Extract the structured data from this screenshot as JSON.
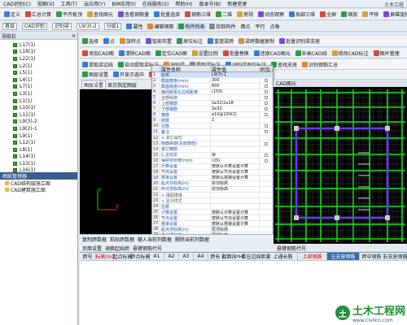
{
  "menubar": {
    "items": [
      "CAD识别(C)",
      "视图(V)",
      "工具(T)",
      "云应用(Y)",
      "BIM应用(I)",
      "在线服务(S)",
      "帮助(H)",
      "版本号(B)",
      "新建变更"
    ],
    "title_right": "土木工程"
  },
  "toolbar1": {
    "items": [
      "定义",
      "汇总计算",
      "平齐板顶",
      "查找图元",
      "查看钢筋量",
      "批量选择",
      "钢筋三维",
      "二维",
      "俯视",
      "动态观察",
      "局部三维",
      "全屏",
      "缩放",
      "平移",
      "屏幕旋转"
    ]
  },
  "toolbar2": {
    "floor": "首层",
    "category": "CAD识别",
    "layer": "识别梁",
    "component": "L9(3)-2",
    "subclass": "分层1",
    "items": [
      "属性",
      "编辑钢筋",
      "构件列表",
      "拾取构件",
      "两点",
      "平行",
      "点角"
    ]
  },
  "toolbar3": {
    "items": [
      "选择",
      "点",
      "旋转点",
      "智能布置",
      "原位标注",
      "重提梁跨",
      "梁跨数据复制",
      "批量识别梁支座"
    ]
  },
  "toolbar4": {
    "items": [
      "添加CAD图",
      "清除CAD图",
      "定位CAD图",
      "设置比例",
      "批量替换",
      "还原CAD图元",
      "补画CAD线",
      "修改CAD标注",
      "图片管理"
    ]
  },
  "toolbar5": {
    "items": [
      "提取梁边线",
      "自动提取梁标注",
      "识别梁",
      "提取梁标注",
      "识别梁原位标注",
      "查找支座",
      "识别钢筋汇总"
    ]
  },
  "toolbar6": {
    "items": [
      "图层设置",
      "只显示选中",
      "识别梁",
      "校核原位标注",
      "启用预制"
    ]
  },
  "left_panel": {
    "header": "导航栏",
    "close": "×",
    "items": [
      "L17(1)",
      "L18(1)",
      "L22(1)",
      "L2(1)",
      "L5(1)",
      "L4(1)",
      "L7(1)",
      "L3(1)",
      "L1(1)",
      "L10(1)",
      "L11(1)",
      "L9(3)-2",
      "L9(2)-1",
      "L9(1)",
      "L12(1)",
      "L8(1)",
      "L14(1)",
      "L13(1)",
      "L16(1)",
      "L15(1)-1",
      "L6(1)"
    ]
  },
  "nav_panel": {
    "header": "图纸管理器",
    "items": [
      "CAD结构层施工图",
      "CAD建筑施工图"
    ]
  },
  "cad_tabs": {
    "items": [
      "图层设置",
      "显示指定图层"
    ]
  },
  "props": {
    "col_attr": "属性名称",
    "col_value": "属性值",
    "col_extra": "附加",
    "rows": [
      {
        "n": "1",
        "name": "名称",
        "value": "L9(3)-2",
        "grp": false,
        "cb": false
      },
      {
        "n": "2",
        "name": "截面宽度(mm)",
        "value": "300",
        "grp": false,
        "cb": true
      },
      {
        "n": "3",
        "name": "截面高度(mm)",
        "value": "600",
        "grp": false,
        "cb": true
      },
      {
        "n": "4",
        "name": "轴线距梁左边线距离",
        "value": "(150)",
        "grp": false,
        "cb": true
      },
      {
        "n": "5",
        "name": "全部纵筋",
        "value": "",
        "grp": true,
        "cb": true
      },
      {
        "n": "6",
        "name": "上部钢筋",
        "value": "2⌀32/2⌀18",
        "grp": false,
        "cb": true
      },
      {
        "n": "7",
        "name": "下部钢筋",
        "value": "3⌀32",
        "grp": false,
        "cb": true
      },
      {
        "n": "8",
        "name": "箍筋",
        "value": "⌀10@100(2)",
        "grp": false,
        "cb": true
      },
      {
        "n": "9",
        "name": "肢数",
        "value": "2",
        "grp": false,
        "cb": false
      },
      {
        "n": "10",
        "name": "拉筋",
        "value": "",
        "grp": false,
        "cb": true
      },
      {
        "n": "11",
        "name": "备注",
        "value": "",
        "grp": false,
        "cb": true
      },
      {
        "n": "12",
        "name": "+ 其它属性",
        "value": "",
        "grp": true,
        "cb": false
      },
      {
        "n": "13",
        "name": "侧面纵筋(总配筋值)",
        "value": "",
        "grp": false,
        "cb": true
      },
      {
        "n": "14",
        "name": "其它箍筋",
        "value": "",
        "grp": false,
        "cb": false
      },
      {
        "n": "15",
        "name": "汇总信息",
        "value": "梁",
        "grp": false,
        "cb": true
      },
      {
        "n": "16",
        "name": "保护层厚度(mm)",
        "value": "(25)",
        "grp": false,
        "cb": true
      },
      {
        "n": "17",
        "name": "计算设置",
        "value": "按默认计算设置计算",
        "grp": false,
        "cb": false
      },
      {
        "n": "18",
        "name": "节点设置",
        "value": "按默认节点设置计算",
        "grp": false,
        "cb": false
      },
      {
        "n": "19",
        "name": "搭接设置",
        "value": "按默认搭接设置计算",
        "grp": false,
        "cb": false
      },
      {
        "n": "20",
        "name": "起点顶标高(m)",
        "value": "层顶标高",
        "grp": false,
        "cb": false
      },
      {
        "n": "21",
        "name": "终点顶标高(m)",
        "value": "层顶标高",
        "grp": false,
        "cb": false
      },
      {
        "n": "22",
        "name": "+ 锚固搭接",
        "value": "",
        "grp": true,
        "cb": false
      },
      {
        "n": "23",
        "name": "+ 显示样式",
        "value": "",
        "grp": true,
        "cb": false
      },
      {
        "n": "24",
        "name": "拉筋",
        "value": "",
        "grp": false,
        "cb": false
      },
      {
        "n": "25",
        "name": "计算设置",
        "value": "按默认计算设置计算",
        "grp": false,
        "cb": false
      },
      {
        "n": "26",
        "name": "节点设置",
        "value": "按默认节点设置计算",
        "grp": false,
        "cb": false
      },
      {
        "n": "27",
        "name": "搭接设置",
        "value": "按默认搭接设置计算",
        "grp": false,
        "cb": false
      },
      {
        "n": "28",
        "name": "起点顶标高(m)",
        "value": "层顶标高",
        "grp": false,
        "cb": false
      },
      {
        "n": "29",
        "name": "终点顶标高(m)",
        "value": "层顶标高",
        "grp": false,
        "cb": false
      }
    ]
  },
  "view_title": "CAD图元",
  "bottom_bar": {
    "row1": [
      "复制跨数据",
      "粘贴跨数据",
      "输入当前列数据",
      "删除当前列数据"
    ],
    "row2": [
      "页面设置",
      "调换起始跨",
      "悬臂钢筋代号"
    ]
  },
  "table": {
    "headers": [
      "跨号",
      "标高(m)",
      "起点标高",
      "终点标高",
      "A1",
      "A2",
      "A3",
      "A4",
      "跨长",
      "截面(B*H)",
      "距左边线距离",
      "上通长筋",
      "上部钢筋",
      "左支座钢筋",
      "跨中钢筋",
      "右支座钢筋"
    ]
  },
  "watermark": {
    "logo": "土",
    "title": "土木工程网",
    "url": "www.civilcn.com"
  },
  "colors": {
    "beam_green": "#19e019",
    "column_purple": "#6a3cff",
    "axis_red": "#ff2a2a",
    "header_blue": "#2f6db3"
  }
}
